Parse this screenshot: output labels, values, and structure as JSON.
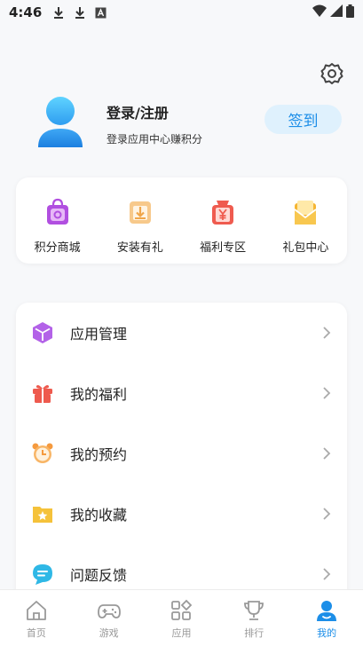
{
  "status_bar": {
    "time": "4:46"
  },
  "profile": {
    "title": "登录/注册",
    "subtitle": "登录应用中心赚积分",
    "checkin_label": "签到"
  },
  "quick_actions": [
    {
      "label": "积分商城",
      "icon": "shopping-bag-icon",
      "color": "#b14fe0"
    },
    {
      "label": "安装有礼",
      "icon": "install-gift-icon",
      "color": "#f0a64a"
    },
    {
      "label": "福利专区",
      "icon": "yen-bag-icon",
      "color": "#ef5b4f"
    },
    {
      "label": "礼包中心",
      "icon": "gift-envelope-icon",
      "color": "#f5b533"
    }
  ],
  "menu": [
    {
      "label": "应用管理",
      "icon": "cube-icon",
      "color": "#b362e8"
    },
    {
      "label": "我的福利",
      "icon": "gift-icon",
      "color": "#ee5a4e"
    },
    {
      "label": "我的预约",
      "icon": "alarm-clock-icon",
      "color": "#f59a3e"
    },
    {
      "label": "我的收藏",
      "icon": "star-folder-icon",
      "color": "#f5c23a"
    },
    {
      "label": "问题反馈",
      "icon": "chat-bubble-icon",
      "color": "#2fb8e6"
    }
  ],
  "tabs": [
    {
      "label": "首页",
      "icon": "home-icon",
      "active": false
    },
    {
      "label": "游戏",
      "icon": "gamepad-icon",
      "active": false
    },
    {
      "label": "应用",
      "icon": "apps-grid-icon",
      "active": false
    },
    {
      "label": "排行",
      "icon": "trophy-icon",
      "active": false
    },
    {
      "label": "我的",
      "icon": "person-icon",
      "active": true
    }
  ],
  "colors": {
    "accent": "#1c8ee8",
    "checkin_bg": "#dff1fd"
  }
}
